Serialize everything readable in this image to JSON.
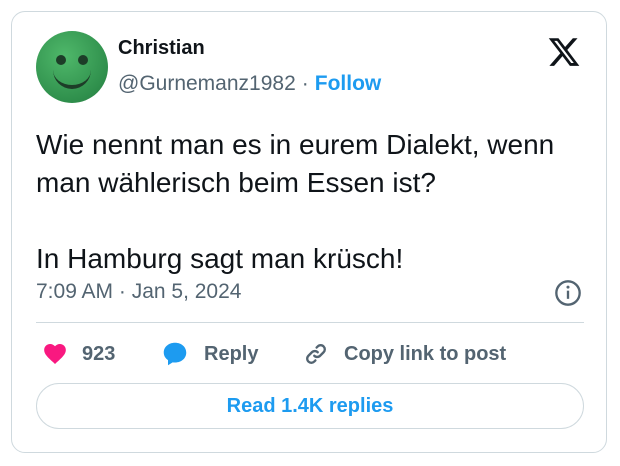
{
  "author": {
    "display_name": "Christian",
    "handle": "@Gurnemanz1982",
    "separator": "·",
    "follow_label": "Follow"
  },
  "tweet": {
    "lines": [
      "Wie nennt man es in eurem Dialekt, wenn man wählerisch beim Essen ist?",
      "In Hamburg sagt man krüsch!"
    ],
    "timestamp": "7:09 AM · Jan 5, 2024"
  },
  "actions": {
    "like_count": "923",
    "reply_label": "Reply",
    "copy_label": "Copy link to post"
  },
  "read_replies_label": "Read 1.4K replies",
  "icons": {
    "logo": "x-logo-icon",
    "info": "info-icon",
    "like": "heart-icon",
    "reply": "speech-bubble-icon",
    "copy": "link-icon"
  },
  "colors": {
    "accent": "#1d9bf0",
    "like": "#f91880",
    "text": "#0f1419",
    "muted": "#536471",
    "border": "#cfd9de"
  }
}
